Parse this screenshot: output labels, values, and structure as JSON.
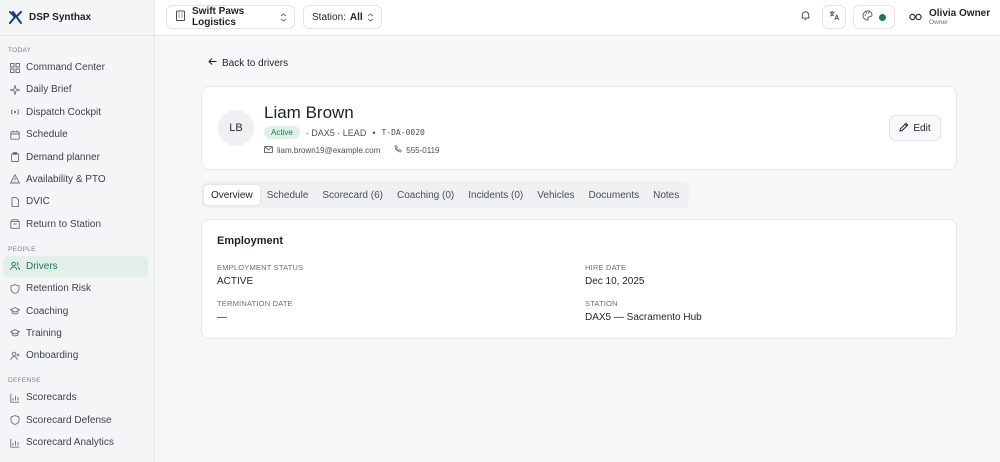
{
  "brand": {
    "name": "DSP Synthax"
  },
  "sidebar": {
    "sections": [
      {
        "title": "TODAY",
        "items": [
          {
            "label": "Command Center",
            "icon": "grid-icon"
          },
          {
            "label": "Daily Brief",
            "icon": "sparkles-icon"
          },
          {
            "label": "Dispatch Cockpit",
            "icon": "radio-icon"
          },
          {
            "label": "Schedule",
            "icon": "calendar-icon"
          },
          {
            "label": "Demand planner",
            "icon": "clipboard-icon"
          },
          {
            "label": "Availability & PTO",
            "icon": "warning-icon"
          },
          {
            "label": "DVIC",
            "icon": "file-icon"
          },
          {
            "label": "Return to Station",
            "icon": "box-icon"
          }
        ]
      },
      {
        "title": "PEOPLE",
        "items": [
          {
            "label": "Drivers",
            "icon": "users-icon",
            "active": true
          },
          {
            "label": "Retention Risk",
            "icon": "shield-icon"
          },
          {
            "label": "Coaching",
            "icon": "graduation-icon"
          },
          {
            "label": "Training",
            "icon": "graduation-icon"
          },
          {
            "label": "Onboarding",
            "icon": "user-plus-icon"
          }
        ]
      },
      {
        "title": "DEFENSE",
        "items": [
          {
            "label": "Scorecards",
            "icon": "bar-chart-icon"
          },
          {
            "label": "Scorecard Defense",
            "icon": "shield-icon"
          },
          {
            "label": "Scorecard Analytics",
            "icon": "bar-chart-icon"
          }
        ]
      }
    ]
  },
  "topbar": {
    "org": "Swift Paws Logistics",
    "station_label": "Station:",
    "station_value": "All",
    "user_name": "Olivia Owner",
    "user_role": "Owner",
    "status_color": "#1c7a55"
  },
  "main": {
    "back_label": "Back to drivers",
    "driver": {
      "initials": "LB",
      "name": "Liam Brown",
      "status": "Active",
      "station_role": "· DAX5 · LEAD",
      "bullet": "•",
      "driver_id": "T-DA-0020",
      "email": "liam.brown19@example.com",
      "phone": "555-0119"
    },
    "edit_label": "Edit",
    "tabs": [
      "Overview",
      "Schedule",
      "Scorecard (6)",
      "Coaching (0)",
      "Incidents (0)",
      "Vehicles",
      "Documents",
      "Notes"
    ],
    "employment": {
      "title": "Employment",
      "status_label": "EMPLOYMENT STATUS",
      "status_value": "ACTIVE",
      "hire_label": "HIRE DATE",
      "hire_value": "Dec 10, 2025",
      "termination_label": "TERMINATION DATE",
      "termination_value": "—",
      "station_label": "STATION",
      "station_value": "DAX5 — Sacramento Hub"
    }
  }
}
